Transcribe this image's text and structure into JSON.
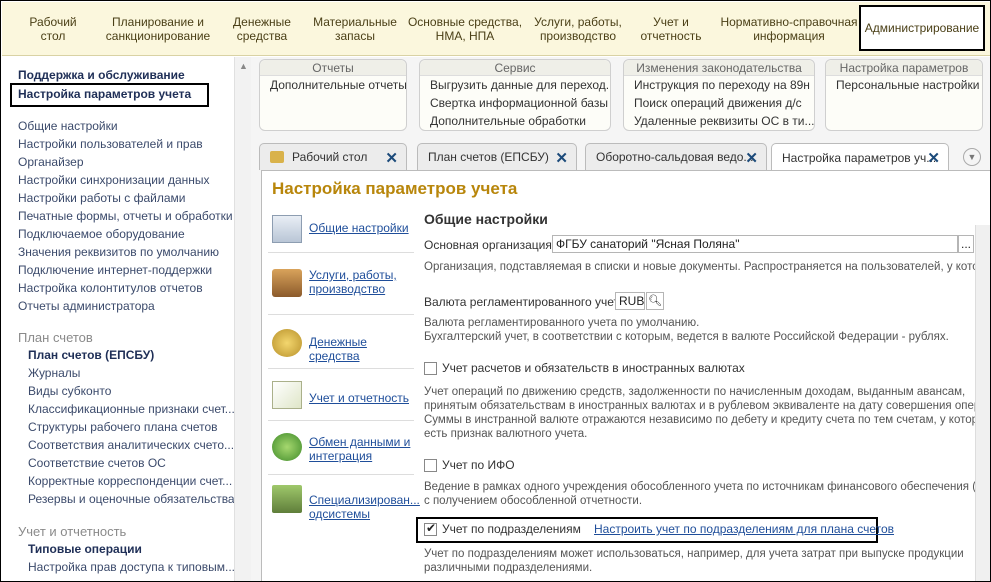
{
  "topnav": [
    {
      "label": "Рабочий\nстол"
    },
    {
      "label": "Планирование и\nсанкционирование"
    },
    {
      "label": "Денежные\nсредства"
    },
    {
      "label": "Материальные\nзапасы"
    },
    {
      "label": "Основные средства,\nНМА, НПА"
    },
    {
      "label": "Услуги, работы,\nпроизводство"
    },
    {
      "label": "Учет и\nотчетность"
    },
    {
      "label": "Нормативно-справочная\nинформация"
    },
    {
      "label": "Администрирование"
    }
  ],
  "sidebar": {
    "top": [
      "Поддержка и обслуживание",
      "Настройка параметров учета"
    ],
    "items": [
      "Общие настройки",
      "Настройки пользователей и прав",
      "Органайзер",
      "Настройки синхронизации данных",
      "Настройки работы с файлами",
      "Печатные формы, отчеты и обработки",
      "Подключаемое оборудование",
      "Значения реквизитов по умолчанию",
      "Подключение интернет-поддержки",
      "Настройка колонтитулов отчетов",
      "Отчеты администратора"
    ],
    "section1": "План счетов",
    "section1_items": [
      "План счетов (ЕПСБУ)",
      "Журналы",
      "Виды субконто",
      "Классификационные признаки счет...",
      "Структуры рабочего плана счетов",
      "Соответствия аналитических счето...",
      "Соответствие счетов ОС",
      "Корректные корреспонденции счет...",
      "Резервы и оценочные обязательства"
    ],
    "section2": "Учет и отчетность",
    "section2_items": [
      "Типовые операции",
      "Настройка прав доступа к типовым..."
    ]
  },
  "panels": [
    {
      "title": "Отчеты",
      "items": [
        "Дополнительные отчеты"
      ]
    },
    {
      "title": "Сервис",
      "items": [
        "Выгрузить данные для переход...",
        "Свертка информационной базы",
        "Дополнительные обработки"
      ]
    },
    {
      "title": "Изменения законодательства",
      "items": [
        "Инструкция по переходу на 89н",
        "Поиск операций движения д/с",
        "Удаленные реквизиты ОС в ти..."
      ]
    },
    {
      "title": "Настройка параметров",
      "items": [
        "Персональные настройки"
      ]
    }
  ],
  "tabs": [
    "Рабочий стол",
    "План счетов (ЕПСБУ)",
    "Оборотно-сальдовая ведо...",
    "Настройка параметров уч..."
  ],
  "content": {
    "title": "Настройка параметров учета",
    "nav": [
      "Общие настройки",
      "Услуги, работы,\nпроизводство",
      "Денежные средства",
      "Учет и отчетность",
      "Обмен данными и\nинтеграция",
      "Специализирован...\nодсистемы"
    ],
    "heading": "Общие настройки",
    "org_label": "Основная организация:",
    "org_value": "ФГБУ санаторий \"Ясная Поляна\"",
    "org_button": "...",
    "org_desc": "Организация, подставляемая в списки и новые документы. Распространяется на пользователей, у которы",
    "cur_label": "Валюта регламентированного учета:",
    "cur_value": "RUB",
    "cur_desc1": "Валюта регламентированного учета по умолчанию.",
    "cur_desc2": "Бухгалтерский учет, в соответствии с которым, ведется в валюте Российской Федерации - рублях.",
    "fx_label": "Учет расчетов и обязательств в иностранных валютах",
    "fx_desc": [
      "Учет операций по движению средств, задолженности по начисленным доходам, выданным авансам,",
      "принятым обязательствам в иностранных валютах и в рублевом эквиваленте на дату совершения операци",
      "Суммы в инстранной валюте отражаются независимо по дебету и кредиту счета по тем счетам, у которых",
      "есть признак валютного учета."
    ],
    "ifo_label": "Учет по ИФО",
    "ifo_desc": [
      "Ведение в рамках одного учреждения обособленного учета по источникам финансового обеспечения (ИФО",
      "с получением обособленной отчетности."
    ],
    "dep_label": "Учет по подразделениям",
    "dep_link": "Настроить учет по подразделениям для плана счетов",
    "dep_desc": [
      "Учет по подразделениям может использоваться, например, для учета затрат при выпуске продукции",
      "различными подразделениями."
    ]
  },
  "colors": {
    "accent": "#b8860b",
    "link": "#1f4e9a",
    "topbar": "#fbf7dd"
  }
}
